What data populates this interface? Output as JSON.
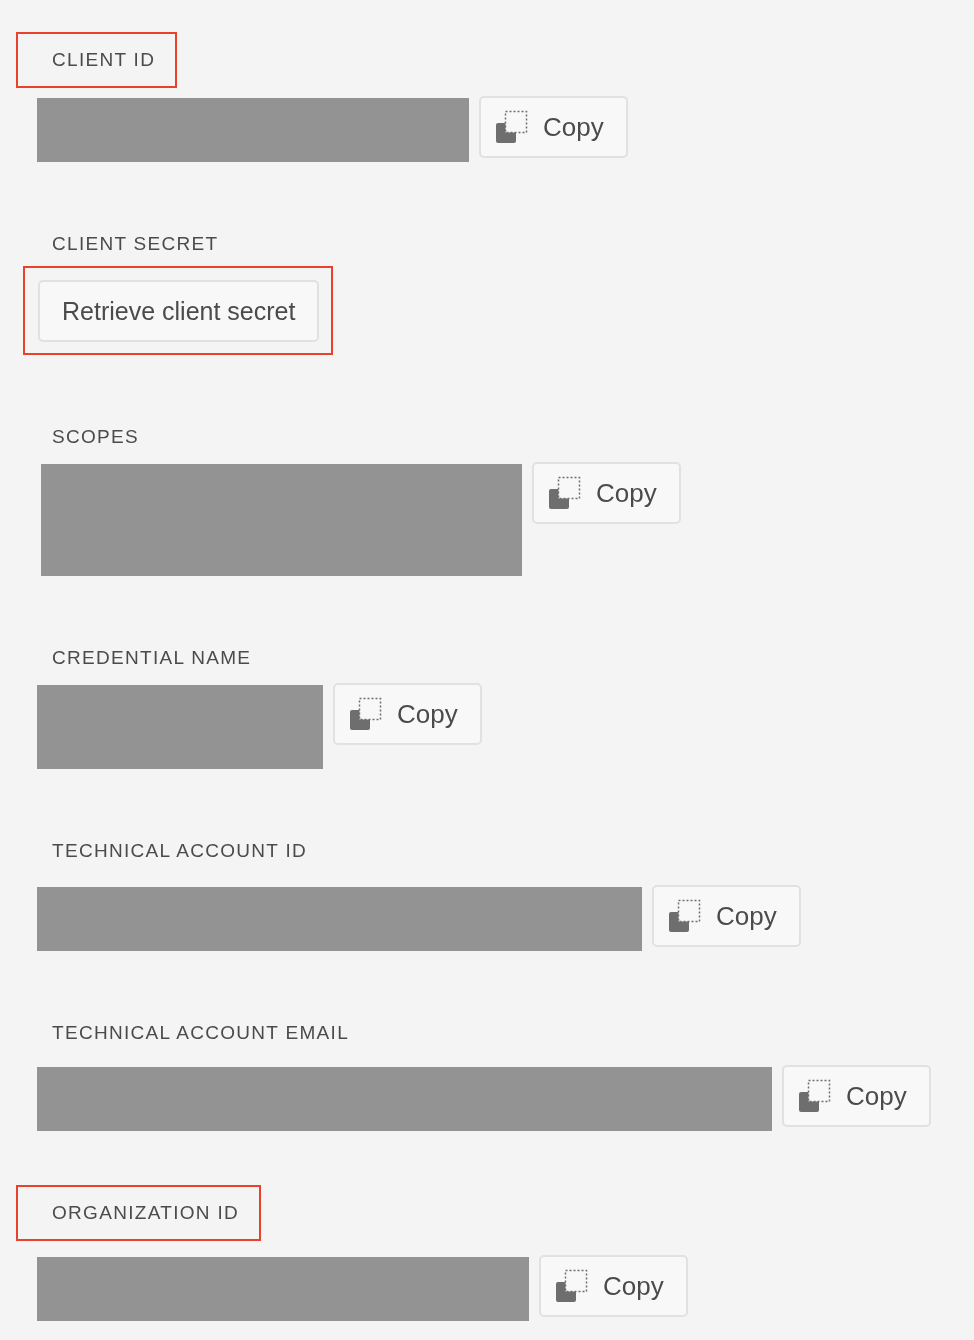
{
  "fields": [
    {
      "kind": "value",
      "label": "CLIENT ID",
      "label_highlighted": true,
      "copy": "Copy"
    },
    {
      "kind": "button",
      "label": "CLIENT SECRET",
      "label_highlighted": false,
      "button": {
        "text": "Retrieve client secret",
        "highlighted": true
      }
    },
    {
      "kind": "value",
      "label": "SCOPES",
      "label_highlighted": false,
      "copy": "Copy"
    },
    {
      "kind": "value",
      "label": "CREDENTIAL NAME",
      "label_highlighted": false,
      "copy": "Copy"
    },
    {
      "kind": "value",
      "label": "TECHNICAL ACCOUNT ID",
      "label_highlighted": false,
      "copy": "Copy"
    },
    {
      "kind": "value",
      "label": "TECHNICAL ACCOUNT EMAIL",
      "label_highlighted": false,
      "copy": "Copy"
    },
    {
      "kind": "value",
      "label": "ORGANIZATION ID",
      "label_highlighted": true,
      "copy": "Copy"
    }
  ]
}
